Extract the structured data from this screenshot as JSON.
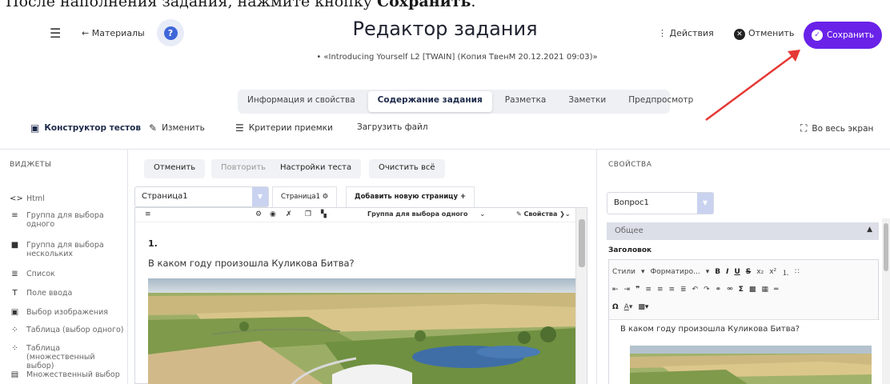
{
  "caption": {
    "prefix": "После наполнения задания, нажмите кнопку ",
    "bold": "Сохранить",
    "suffix": "."
  },
  "header": {
    "back_label": "← Материалы",
    "help_glyph": "?",
    "title": "Редактор задания",
    "subtitle": "• «Introducing Yourself L2 [TWAIN] (Копия ТвенМ 20.12.2021 09:03)»",
    "actions_label": "⋮ Действия",
    "cancel_label": "Отменить",
    "save_label": "Сохранить"
  },
  "tabs": [
    {
      "label": "Информация и свойства",
      "active": false
    },
    {
      "label": "Содержание задания",
      "active": true
    },
    {
      "label": "Разметка",
      "active": false
    },
    {
      "label": "Заметки",
      "active": false
    },
    {
      "label": "Предпросмотр",
      "active": false
    }
  ],
  "toolbar": {
    "constructor": "Конструктор тестов",
    "edit": "Изменить",
    "criteria": "Критерии приемки",
    "upload": "Загрузить файл",
    "fullscreen": "Во весь экран"
  },
  "widgets": {
    "title": "ВИДЖЕТЫ",
    "items": [
      {
        "icon": "<>",
        "label": "Html"
      },
      {
        "icon": "≡",
        "label": "Группа для выбора одного"
      },
      {
        "icon": "■",
        "label": "Группа для выбора нескольких"
      },
      {
        "icon": "≣",
        "label": "Список"
      },
      {
        "icon": "T",
        "label": "Поле ввода"
      },
      {
        "icon": "▣",
        "label": "Выбор изображения"
      },
      {
        "icon": "⁘",
        "label": "Таблица (выбор одного)"
      },
      {
        "icon": "⁘",
        "label": "Таблица (множественный выбор)"
      },
      {
        "icon": "▤",
        "label": "Множественный выбор"
      }
    ]
  },
  "center": {
    "undo": "Отменить",
    "redo": "Повторить",
    "test_settings": "Настройки теста",
    "clear_all": "Очистить всё",
    "page_select": "Страница1",
    "page_tab": "Страница1 ⚙",
    "add_page": "Добавить новую страницу +",
    "group_select": "Группа для выбора одного",
    "properties_link": "Свойства",
    "question_number": "1.",
    "question_text": "В каком году произошла Куликова Битва?"
  },
  "properties": {
    "title": "СВОЙСТВА",
    "question_select": "Вопрос1",
    "section": "Общее",
    "field_label": "Заголовок",
    "styles": "Стили",
    "format": "Форматиро...",
    "editor_text": "В каком году произошла Куликова Битва?"
  }
}
